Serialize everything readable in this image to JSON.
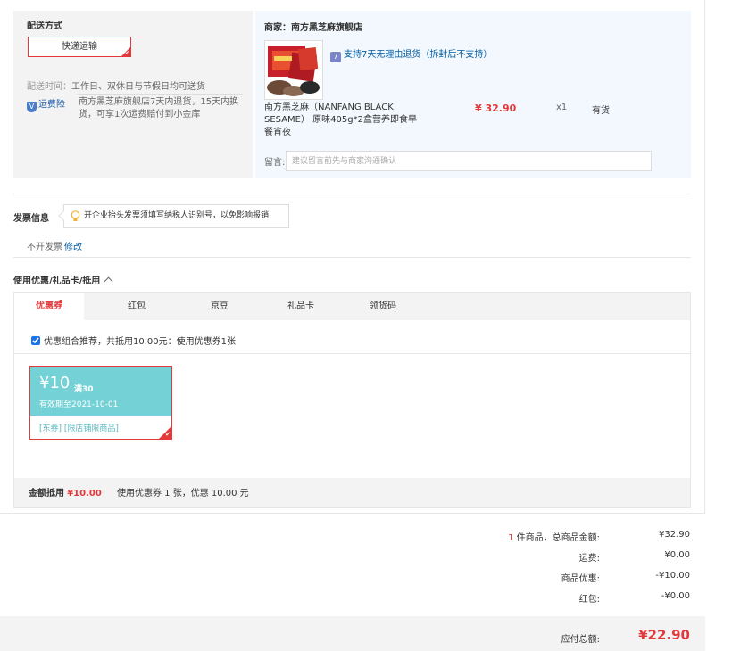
{
  "delivery": {
    "title": "配送方式",
    "method_label": "快递运输",
    "time_label": "配送时间：",
    "time_value": "工作日、双休日与节假日均可送货",
    "insurance_badge": "运费险",
    "insurance_text": "南方黑芝麻旗舰店7天内退货，15天内换货，可享1次运费赔付到小金库"
  },
  "merchant": {
    "shop_name": "商家：南方黑芝麻旗舰店",
    "return_policy": "支持7天无理由退货（拆封后不支持）",
    "product_name": "南方黑芝麻（NANFANG BLACK SESAME） 原味405g*2盒营养即食早餐宵夜",
    "price": "¥ 32.90",
    "quantity": "x1",
    "stock": "有货",
    "message_label": "留言:",
    "message_placeholder": "建议留言前先与商家沟通确认"
  },
  "invoice": {
    "title": "发票信息",
    "tip": "开企业抬头发票须填写纳税人识别号，以免影响报销",
    "status": "不开发票",
    "edit_link": "修改"
  },
  "coupons": {
    "title": "使用优惠/礼品卡/抵用",
    "tabs": [
      {
        "label": "优惠券"
      },
      {
        "label": "红包"
      },
      {
        "label": "京豆"
      },
      {
        "label": "礼品卡"
      },
      {
        "label": "领货码"
      }
    ],
    "combo_text": "优惠组合推荐，共抵用10.00元：使用优惠券1张",
    "coupon": {
      "amount": "¥10",
      "condition": "满30",
      "expiry": "有效期至2021-10-01",
      "tags": "[东券] [限店铺限商品]"
    },
    "footer_label": "金额抵用",
    "footer_amount": "¥10.00",
    "footer_detail": "使用优惠券 1 张，优惠 10.00 元"
  },
  "summary": {
    "count": "1",
    "items_label": "件商品，总商品金额:",
    "items_value": "¥32.90",
    "shipping_label": "运费:",
    "shipping_value": "¥0.00",
    "discount_label": "商品优惠:",
    "discount_value": "-¥10.00",
    "redpacket_label": "红包:",
    "redpacket_value": "-¥0.00",
    "total_label": "应付总额:",
    "total_value": "¥22.90"
  },
  "colors": {
    "accent_red": "#e4393c",
    "link_blue": "#005aa0",
    "coupon_teal": "#74d2d6"
  }
}
